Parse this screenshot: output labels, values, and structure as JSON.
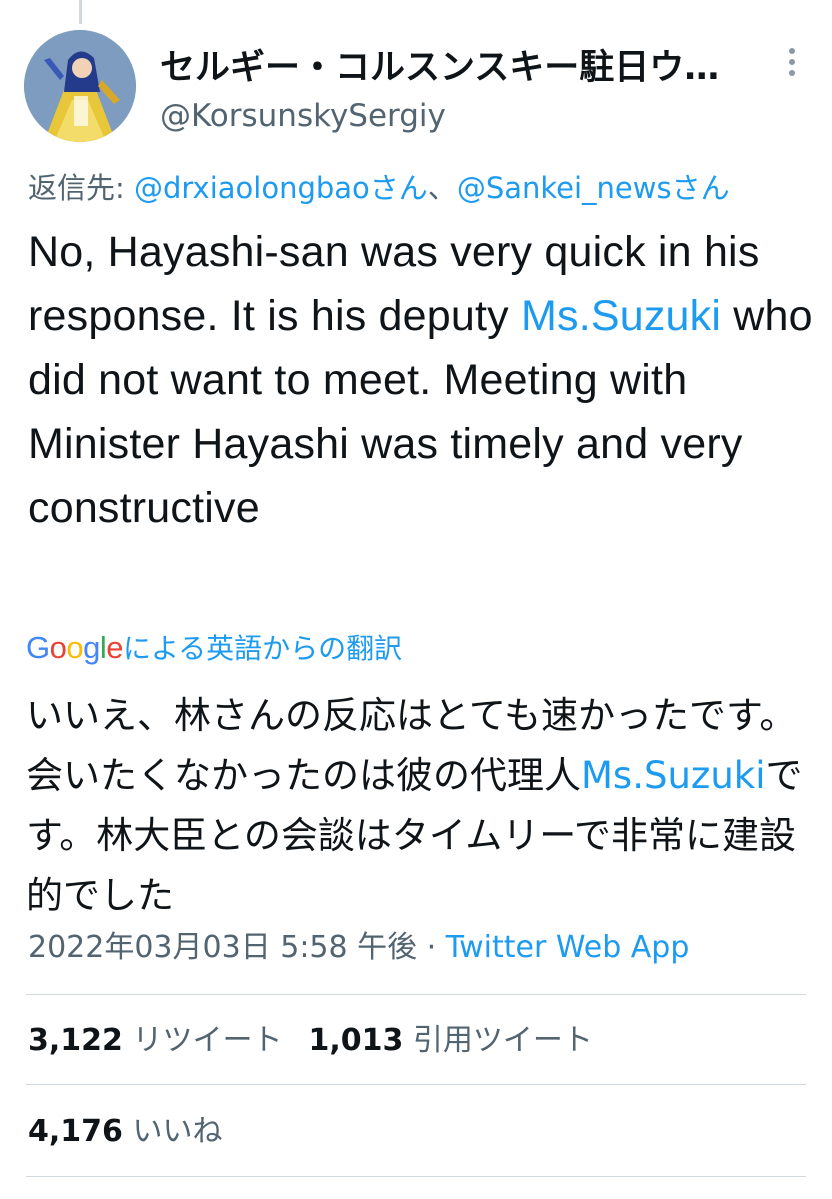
{
  "author": {
    "display_name": "セルギー・コルスンスキー駐日ウ…",
    "handle": "@KorsunskySergiy",
    "avatar_icon": "avatar-illustration"
  },
  "more_icon": "more-options-icon",
  "reply_to": {
    "prefix": "返信先: ",
    "mention_1": "@drxiaolongbaoさん",
    "separator": "、",
    "mention_2": "@Sankei_newsさん"
  },
  "tweet": {
    "text_before": "No, Hayashi-san was very quick in his response. It is his deputy ",
    "mention": "Ms.Suzuki",
    "text_after": " who did not want to meet. Meeting with Minister Hayashi was timely and very constructive"
  },
  "translation": {
    "google_logo": "Google",
    "caption": "による英語からの翻訳",
    "text_before": "いいえ、林さんの反応はとても速かったです。会いたくなかったのは彼の代理人",
    "mention": "Ms.Suzuki",
    "text_after": "です。林大臣との会談はタイムリーで非常に建設的でした"
  },
  "meta": {
    "timestamp": "2022年03月03日 5:58 午後",
    "separator": " · ",
    "source": "Twitter Web App"
  },
  "stats": {
    "retweets_count": "3,122",
    "retweets_label": "リツイート",
    "quotes_count": "1,013",
    "quotes_label": "引用ツイート",
    "likes_count": "4,176",
    "likes_label": "いいね"
  },
  "colors": {
    "link": "#1d9bf0",
    "secondary_text": "#536471",
    "primary_text": "#0f1419",
    "divider": "#cfd9de"
  }
}
